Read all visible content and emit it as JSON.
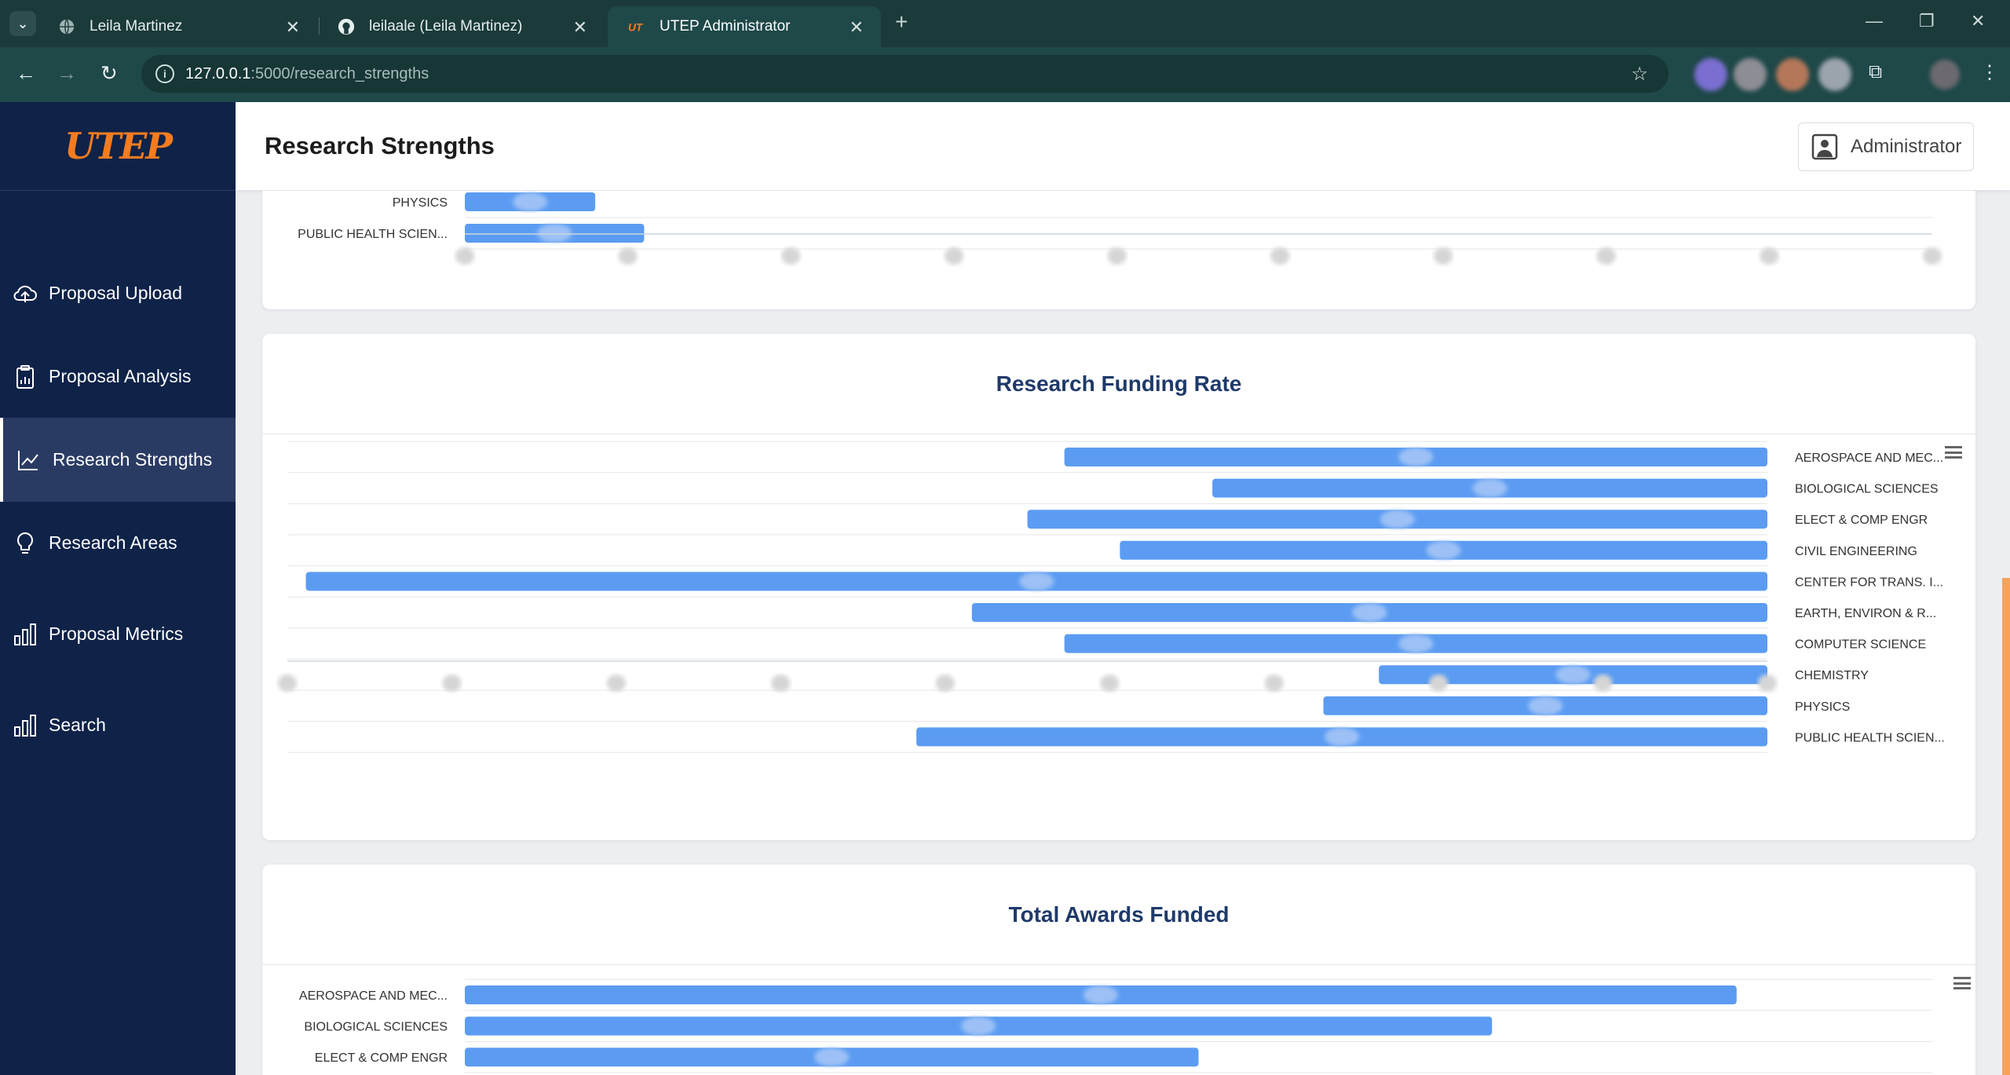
{
  "browser": {
    "tabs": [
      {
        "label": "Leila Martinez",
        "icon": "globe-icon"
      },
      {
        "label": "leilaale (Leila Martinez)",
        "icon": "github-icon"
      },
      {
        "label": "UTEP Administrator",
        "icon": "utep-favicon-icon",
        "active": true
      }
    ],
    "url_host": "127.0.0.1",
    "url_path": ":5000/research_strengths"
  },
  "sidebar": {
    "logo": "UTEP",
    "items": [
      {
        "label": "Proposal Upload",
        "icon": "cloud-upload-icon"
      },
      {
        "label": "Proposal Analysis",
        "icon": "clipboard-chart-icon"
      },
      {
        "label": "Research Strengths",
        "icon": "line-chart-icon",
        "active": true
      },
      {
        "label": "Research Areas",
        "icon": "lightbulb-icon"
      },
      {
        "label": "Proposal Metrics",
        "icon": "bar-chart-icon"
      },
      {
        "label": "Search",
        "icon": "bar-chart-icon"
      }
    ]
  },
  "header": {
    "title": "Research Strengths",
    "user_label": "Administrator"
  },
  "colors": {
    "bar": "#5b9cf2",
    "sidebar_bg": "#0f2248",
    "accent": "#f47c20",
    "title": "#1f3a6a"
  },
  "chart_data": [
    {
      "type": "bar",
      "orientation": "horizontal",
      "title": "",
      "categories": [
        "PHYSICS",
        "PUBLIC HEALTH SCIEN..."
      ],
      "values": [
        8,
        11
      ],
      "xlim": [
        0,
        90
      ],
      "grid": true
    },
    {
      "type": "bar",
      "orientation": "horizontal",
      "axis_side": "right",
      "x_reversed": true,
      "title": "Research Funding Rate",
      "categories": [
        "AEROSPACE AND MEC...",
        "BIOLOGICAL SCIENCES",
        "ELECT & COMP ENGR",
        "CIVIL ENGINEERING",
        "CENTER FOR TRANS. I...",
        "EARTH, ENVIRON & R...",
        "COMPUTER SCIENCE",
        "CHEMISTRY",
        "PHYSICS",
        "PUBLIC HEALTH SCIEN..."
      ],
      "values": [
        38,
        30,
        40,
        35,
        79,
        43,
        38,
        21,
        24,
        46
      ],
      "xlim": [
        0,
        80
      ],
      "grid": true
    },
    {
      "type": "bar",
      "orientation": "horizontal",
      "title": "Total Awards Funded",
      "categories": [
        "AEROSPACE AND MEC...",
        "BIOLOGICAL SCIENCES",
        "ELECT & COMP ENGR"
      ],
      "values": [
        78,
        63,
        45
      ],
      "xlim": [
        0,
        90
      ],
      "grid": true
    }
  ]
}
